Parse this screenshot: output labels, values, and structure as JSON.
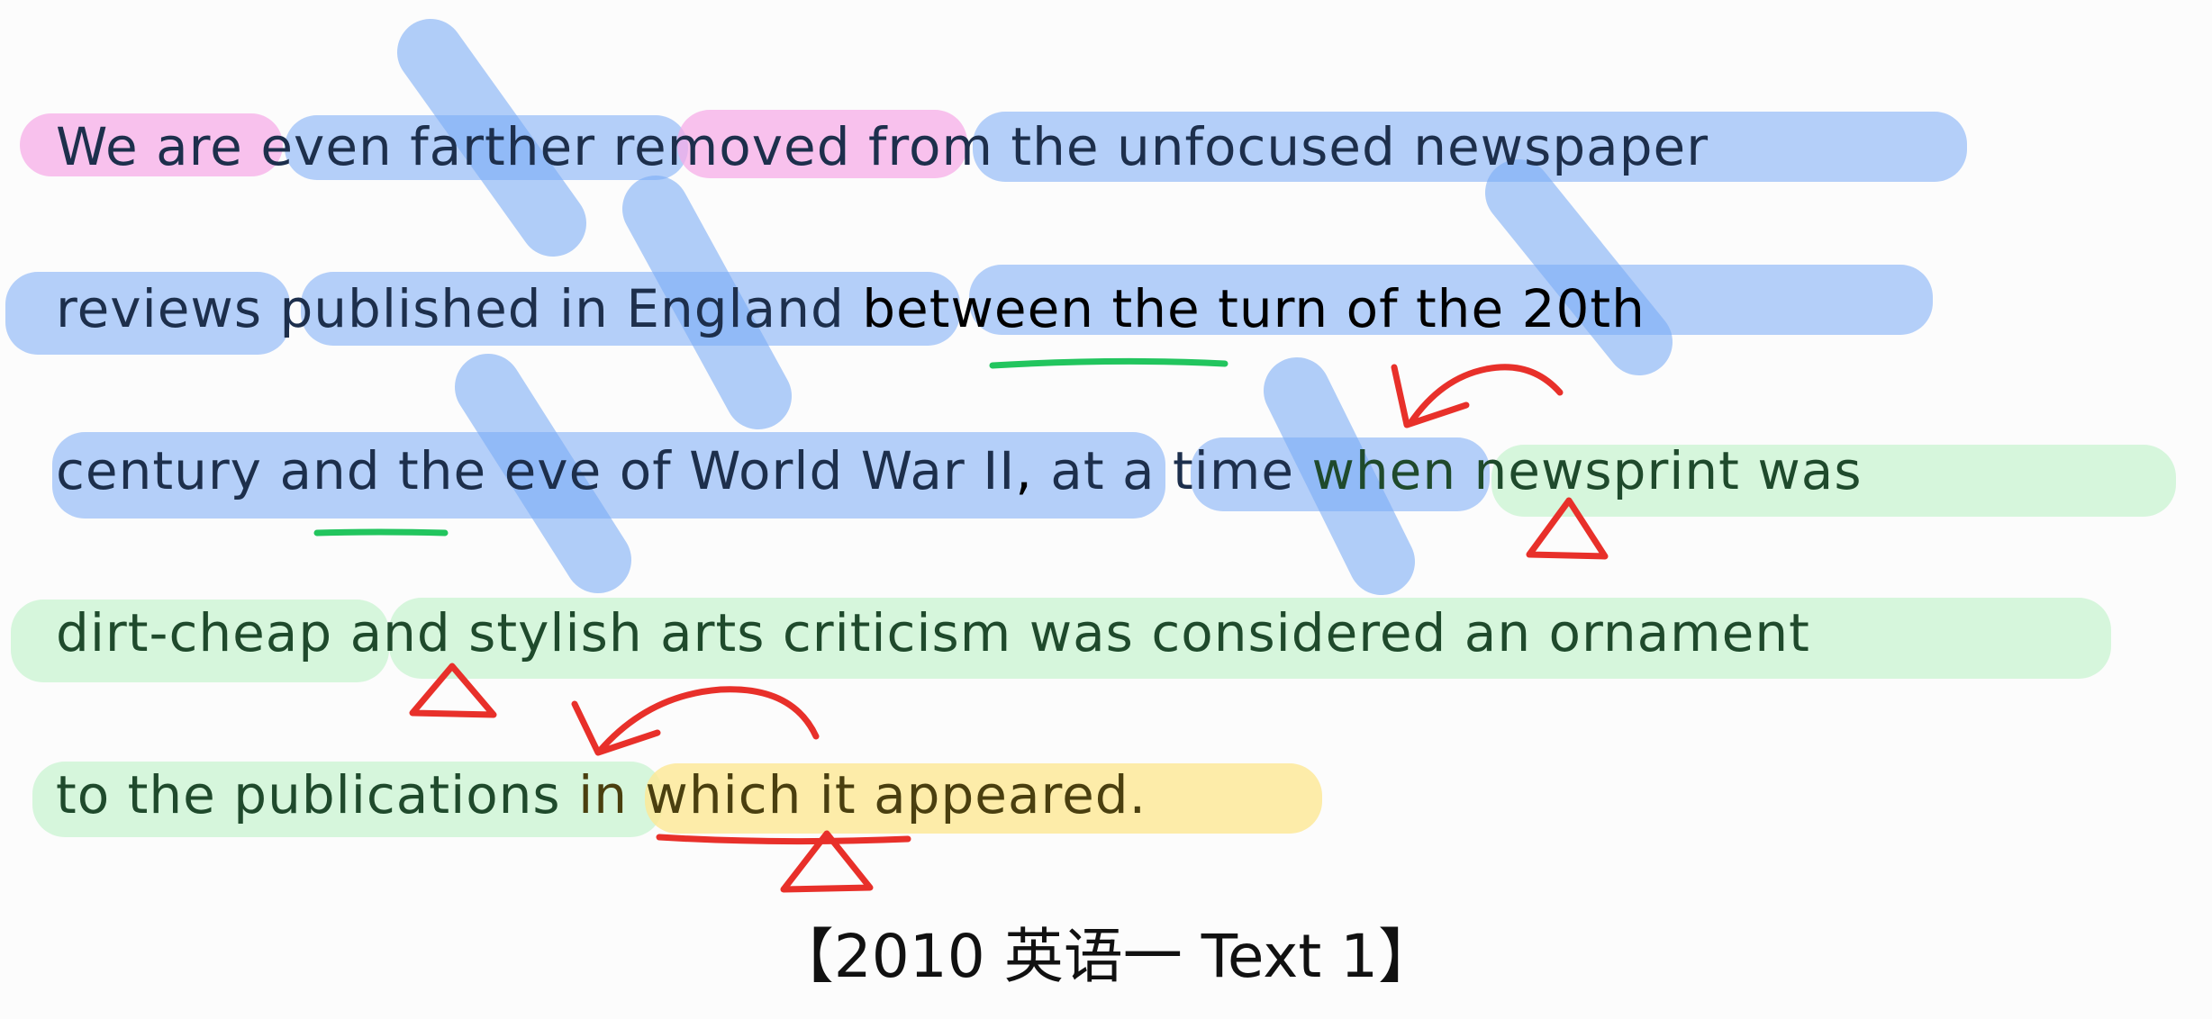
{
  "lines": [
    {
      "segments": [
        {
          "text": "We are ",
          "tone": "pink"
        },
        {
          "text": "even farther ",
          "tone": "blue"
        },
        {
          "text": "removed ",
          "tone": "pink"
        },
        {
          "text": "from the unfocused newspaper",
          "tone": "blue"
        }
      ]
    },
    {
      "segments": [
        {
          "text": "reviews published in England ",
          "tone": "blue"
        },
        {
          "text": "between the turn of the 20th",
          "tone": "blue"
        }
      ]
    },
    {
      "segments": [
        {
          "text": "century and the eve of World War II",
          "tone": "blue"
        },
        {
          "text": ", ",
          "tone": "none"
        },
        {
          "text": "at a time ",
          "tone": "blue"
        },
        {
          "text": "when newsprint was",
          "tone": "green"
        }
      ]
    },
    {
      "segments": [
        {
          "text": "dirt-cheap ",
          "tone": "green"
        },
        {
          "text": "and stylish arts criticism was considered an ornament",
          "tone": "green"
        }
      ]
    },
    {
      "segments": [
        {
          "text": "to the publications ",
          "tone": "green"
        },
        {
          "text": "in which it appeared.",
          "tone": "yellow"
        }
      ]
    }
  ],
  "caption": "【2010 英语一 Text 1】",
  "colors": {
    "blue_highlight": "#78aaf5",
    "pink_highlight": "#f6aae8",
    "green_highlight": "#bef2c8",
    "yellow_highlight": "#fce896",
    "annotation_red": "#e8302a",
    "annotation_green": "#22c55e",
    "text_dark": "#1d2f4c"
  },
  "annotation_marks": [
    "slash-mark",
    "curved-arrow-icon",
    "triangle-icon",
    "underline-mark"
  ]
}
